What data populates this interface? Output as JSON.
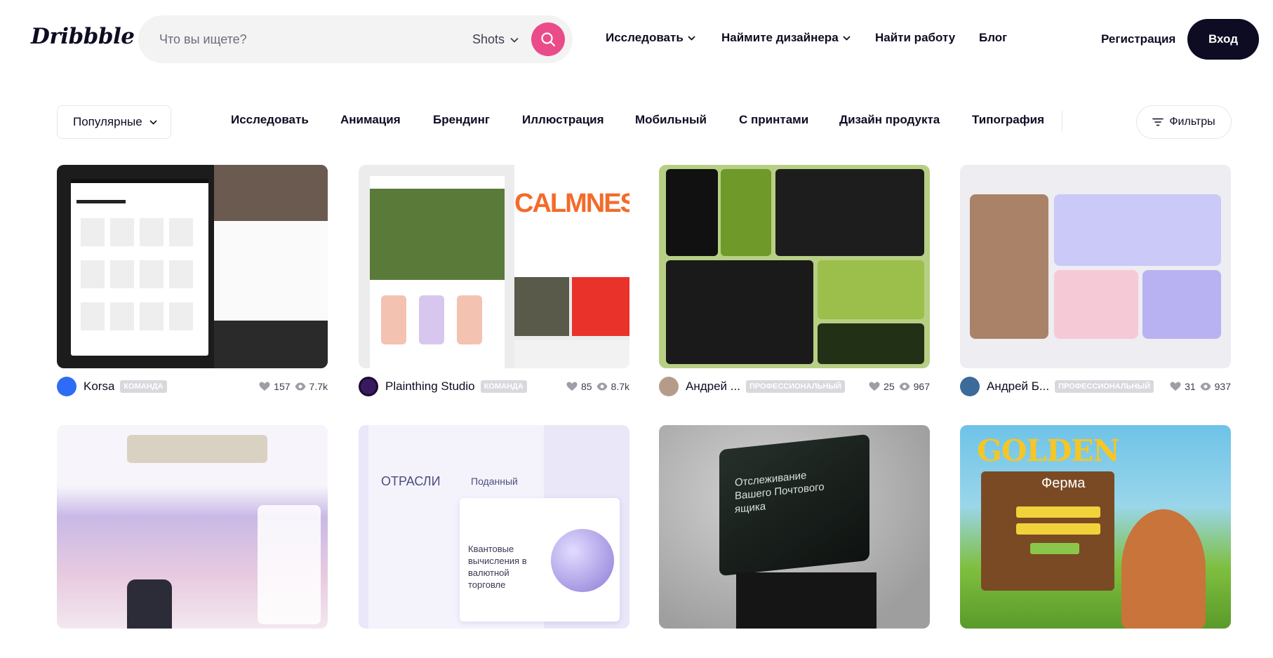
{
  "header": {
    "logo": "Dribbble",
    "search_placeholder": "Что вы ищете?",
    "search_type": "Shots",
    "nav": [
      {
        "label": "Исследовать",
        "dropdown": true
      },
      {
        "label": "Наймите дизайнера",
        "dropdown": true
      },
      {
        "label": "Найти работу",
        "dropdown": false
      },
      {
        "label": "Блог",
        "dropdown": false
      }
    ],
    "signup": "Регистрация",
    "login": "Вход"
  },
  "filterbar": {
    "sort": "Популярные",
    "categories": [
      "Исследовать",
      "Анимация",
      "Брендинг",
      "Иллюстрация",
      "Мобильный",
      "С принтами",
      "Дизайн продукта",
      "Типография"
    ],
    "filters": "Фильтры"
  },
  "colors": {
    "accent": "#ea4c89",
    "dark": "#0d0c22",
    "badge": "#d9d8dd"
  },
  "shots": [
    {
      "author": "Korsa",
      "badge": "КОМАНДА",
      "likes": "157",
      "views": "7.7k"
    },
    {
      "author": "Plainthing Studio",
      "badge": "КОМАНДА",
      "likes": "85",
      "views": "8.7k"
    },
    {
      "author": "Андрей ...",
      "badge": "ПРОФЕССИОНАЛЬНЫЙ",
      "likes": "25",
      "views": "967"
    },
    {
      "author": "Андрей Б...",
      "badge": "ПРОФЕССИОНАЛЬНЫЙ",
      "likes": "31",
      "views": "937"
    },
    {
      "author": "",
      "badge": "",
      "likes": "",
      "views": ""
    },
    {
      "author": "",
      "badge": "",
      "likes": "",
      "views": ""
    },
    {
      "author": "",
      "badge": "",
      "likes": "",
      "views": ""
    },
    {
      "author": "",
      "badge": "",
      "likes": "",
      "views": ""
    }
  ],
  "thumb_text": {
    "shot2_word": "CALMNESS",
    "shot6_title": "ОТРАСЛИ",
    "shot6_sub": "Поданный",
    "shot6_body": "Квантовые вычисления в валютной торговле",
    "shot7_title": "Отслеживание Вашего Почтового ящика",
    "shot8_title": "GOLDEN",
    "shot8_sub": "Ферма"
  }
}
